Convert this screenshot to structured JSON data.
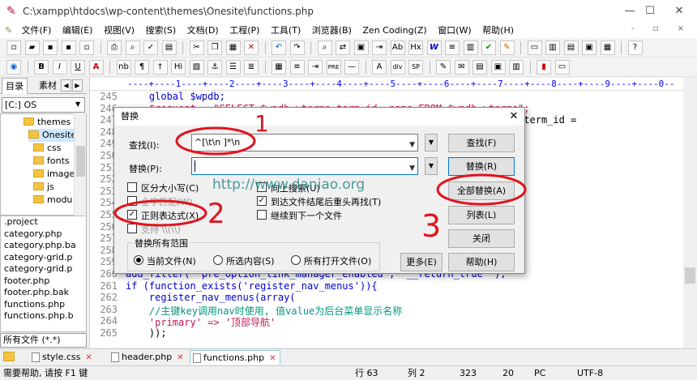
{
  "window": {
    "title": "C:\\xampp\\htdocs\\wp-content\\themes\\Onesite\\functions.php",
    "minimize": "—",
    "maximize": "☐",
    "close": "✕"
  },
  "menu": [
    "文件(F)",
    "编辑(E)",
    "视图(V)",
    "搜索(S)",
    "文档(D)",
    "工程(P)",
    "工具(T)",
    "浏览器(B)",
    "Zen Coding(Z)",
    "窗口(W)",
    "帮助(H)"
  ],
  "mdi_controls": "- ▫ ×",
  "toolbar2": {
    "b": "B",
    "i": "I",
    "u": "U",
    "a": "A",
    "nb": "nb",
    "pi": "¶",
    "dagger": "†",
    "hi": "Hi",
    "pre": "PRE",
    "div": "div",
    "sp": "SP"
  },
  "toolbar1_labels": {
    "ab": "Ab",
    "hx": "Hx",
    "w": "W"
  },
  "sidebar": {
    "tab_dir": "目录",
    "tab_clip": "素材",
    "nav_prev": "◀",
    "nav_next": "▶",
    "drive": "[C:] OS",
    "tree": [
      "themes",
      "Onesite",
      "css",
      "fonts",
      "image",
      "js",
      "modu"
    ],
    "files": [
      ".project",
      "category.php",
      "category.php.ba",
      "category-grid.p",
      "category-grid.p",
      "footer.php",
      "footer.php.bak",
      "functions.php",
      "functions.php.b"
    ],
    "filter": "所有文件 (*.*)"
  },
  "editor": {
    "ruler": "----+----1----+----2----+----3----+----4----+----5----+----6----+----7----+----8----+----9----+----0--",
    "lines": [
      {
        "n": "245",
        "text": "    global $wpdb;"
      },
      {
        "n": "246",
        "text": "    $request = \"SELECT $wpdb->terms.term_id, name FROM $wpdb->terms\";"
      },
      {
        "n": "247",
        "text": "                                                            axonomy.term_id ="
      },
      {
        "n": "248",
        "text": "                                                              ' \";"
      },
      {
        "n": "249",
        "text": ""
      },
      {
        "n": "250",
        "text": ""
      },
      {
        "n": "251",
        "text": ""
      },
      {
        "n": "252",
        "text": ""
      },
      {
        "n": "253",
        "text": ""
      },
      {
        "n": "254",
        "text": ""
      },
      {
        "n": "255",
        "text": ""
      },
      {
        "n": "256",
        "text": ""
      },
      {
        "n": "257",
        "text": ""
      },
      {
        "n": "258",
        "text": ""
      },
      {
        "n": "259",
        "text": ""
      },
      {
        "n": "260",
        "text": "add_filter( 'pre_option_link_manager_enabled', '__return_true' );"
      },
      {
        "n": "261",
        "text": "if (function_exists('register_nav_menus')){"
      },
      {
        "n": "262",
        "text": "    register_nav_menus(array("
      },
      {
        "n": "263",
        "text": "    //主键key调用nav时使用, 值value为后台菜单显示名称"
      },
      {
        "n": "264",
        "text": "    'primary' => '顶部导航'"
      },
      {
        "n": "265",
        "text": "    ));"
      }
    ]
  },
  "doc_tabs": [
    {
      "name": "style.css",
      "close": "✕"
    },
    {
      "name": "header.php",
      "close": "✕"
    },
    {
      "name": "functions.php",
      "close": "✕"
    }
  ],
  "status": {
    "help": "需要帮助, 请按 F1 键",
    "line": "行 63",
    "col": "列 2",
    "size": "323",
    "num": "20",
    "os": "PC",
    "enc": "UTF-8"
  },
  "dialog": {
    "title": "替换",
    "close": "✕",
    "find_label": "查找(I):",
    "find_value": "^[\\t\\n ]*\\n",
    "replace_label": "替换(P):",
    "replace_value": "",
    "dropdown_arrow": "▼",
    "spin": "▲",
    "options": {
      "case": "区分大小写(C)",
      "whole_word": "全字匹配(W)",
      "regex": "正则表达式(X)",
      "unix": "支持 \\\\(\\\\)",
      "up": "向上搜索(U)",
      "wrap": "到达文件结尾后重头再找(T)",
      "next_file": "继续到下一个文件"
    },
    "checked_mark": "✓",
    "scope_title": "替换所有范围",
    "scope": {
      "current": "当前文件(N)",
      "selection": "所选内容(S)",
      "all_open": "所有打开文件(O)"
    },
    "buttons": {
      "find": "查找(F)",
      "replace": "替换(R)",
      "replace_all": "全部替换(A)",
      "list": "列表(L)",
      "close": "关闭",
      "more": "更多(E)",
      "help": "帮助(H)"
    }
  },
  "annotations": {
    "n1": "1",
    "n2": "2",
    "n3": "3",
    "watermark": "http://www.daniao.org"
  },
  "colors": {
    "annotation_red": "#e0141e",
    "accent": "#0078d7"
  }
}
